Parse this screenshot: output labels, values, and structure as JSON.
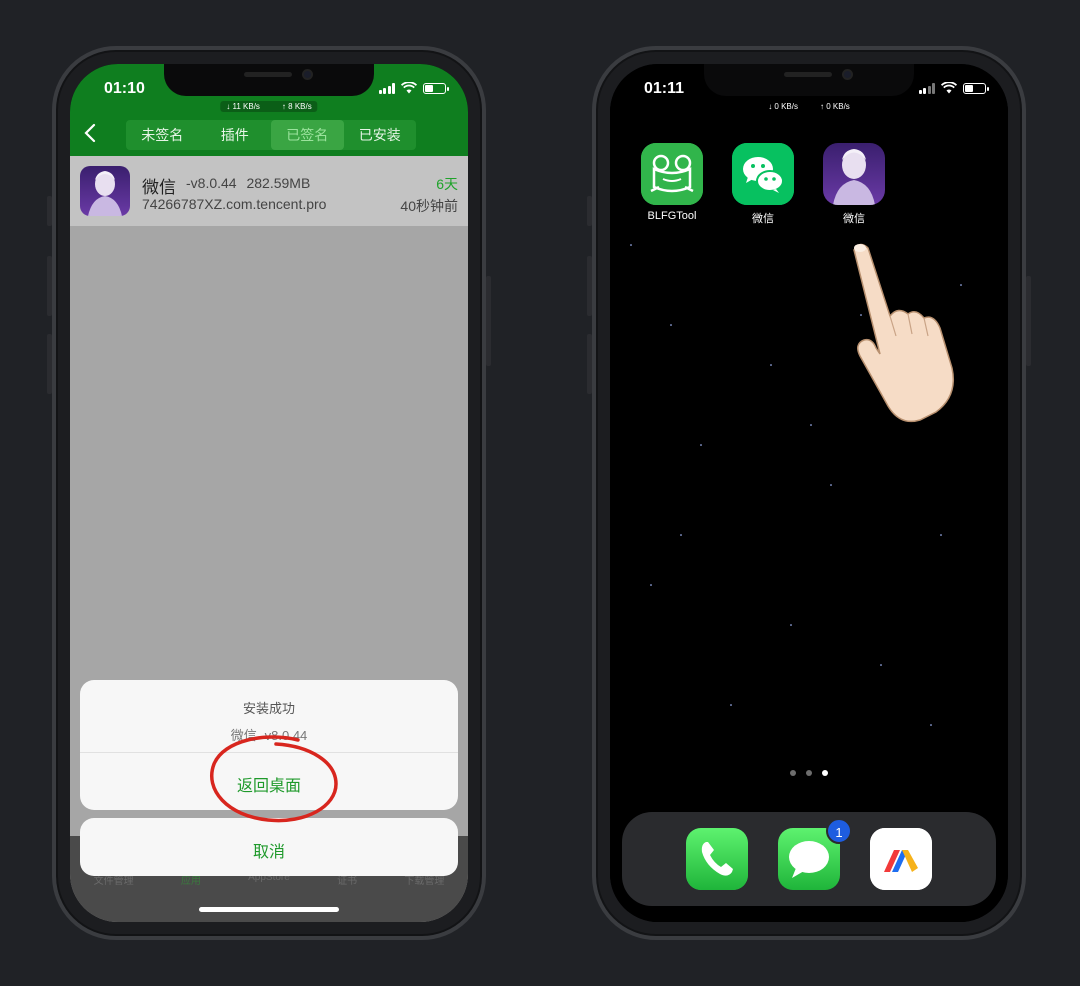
{
  "left_phone": {
    "status": {
      "time": "01:10",
      "down": "↓ 11 KB/s",
      "up": "↑ 8 KB/s"
    },
    "tabs": [
      {
        "label": "未签名"
      },
      {
        "label": "插件"
      },
      {
        "label": "已签名"
      },
      {
        "label": "已安装"
      }
    ],
    "active_tab": "已签名",
    "app_row": {
      "name": "微信",
      "meta": "-v8.0.44 282.59MB",
      "bundle": "74266787XZ.com.tencent.pro",
      "days": "6天",
      "time_ago": "40秒钟前"
    },
    "tabbar": [
      {
        "label": "文件管理"
      },
      {
        "label": "应用"
      },
      {
        "label": "AppStore"
      },
      {
        "label": "证书"
      },
      {
        "label": "下载管理"
      }
    ],
    "sheet": {
      "title": "安装成功",
      "subtitle": "微信 -v8.0.44",
      "action": "返回桌面",
      "cancel": "取消"
    }
  },
  "right_phone": {
    "status": {
      "time": "01:11",
      "down": "↓ 0 KB/s",
      "up": "↑ 0 KB/s"
    },
    "apps": [
      {
        "label": "BLFGTool",
        "icon": "frog-icon"
      },
      {
        "label": "微信",
        "icon": "wechat-icon"
      },
      {
        "label": "微信",
        "icon": "avatar-portrait-icon"
      }
    ],
    "page_dots": {
      "count": 3,
      "active": 2
    },
    "dock": [
      {
        "name": "Phone",
        "icon": "phone-icon"
      },
      {
        "name": "Messages",
        "icon": "message-bubble-icon",
        "badge": "1"
      },
      {
        "name": "Infuse",
        "icon": "stripes-logo-icon"
      }
    ]
  },
  "colors": {
    "header_green": "#0f7e1f",
    "action_green": "#1f9a2b",
    "annotation_red": "#d8261e",
    "wechat_green": "#07c160"
  }
}
